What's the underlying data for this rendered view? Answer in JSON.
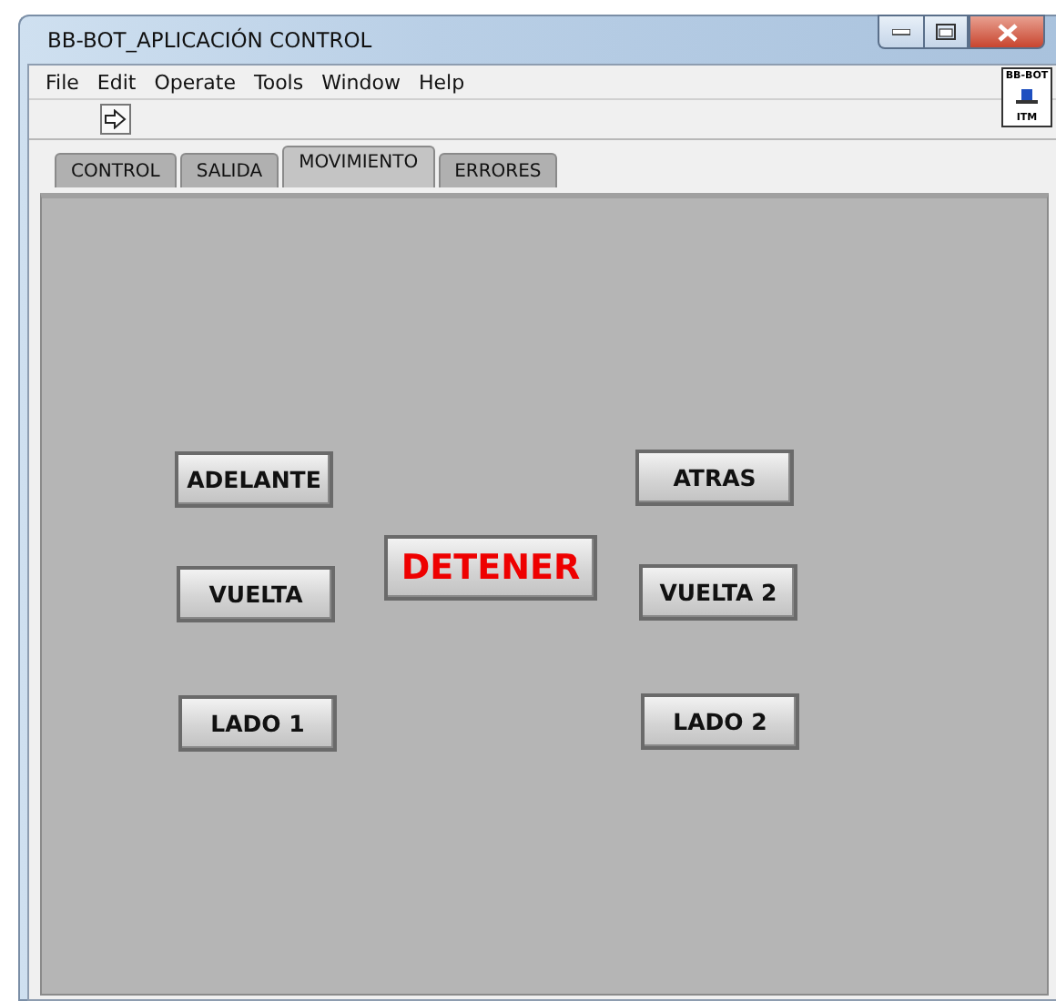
{
  "window": {
    "title": "BB-BOT_APLICACIÓN CONTROL"
  },
  "menu": [
    "File",
    "Edit",
    "Operate",
    "Tools",
    "Window",
    "Help"
  ],
  "vi_icon": {
    "top_text": "BB-BOT",
    "bottom_text": "ITM"
  },
  "tabs": [
    {
      "label": "CONTROL",
      "selected": false
    },
    {
      "label": "SALIDA",
      "selected": false
    },
    {
      "label": "MOVIMIENTO",
      "selected": true
    },
    {
      "label": "ERRORES",
      "selected": false
    }
  ],
  "buttons": [
    {
      "label": "ADELANTE",
      "kind": "move"
    },
    {
      "label": "ATRAS",
      "kind": "move"
    },
    {
      "label": "DETENER",
      "kind": "stop"
    },
    {
      "label": "VUELTA",
      "kind": "move"
    },
    {
      "label": "VUELTA 2",
      "kind": "move"
    },
    {
      "label": "LADO 1",
      "kind": "move"
    },
    {
      "label": "LADO 2",
      "kind": "move"
    }
  ]
}
